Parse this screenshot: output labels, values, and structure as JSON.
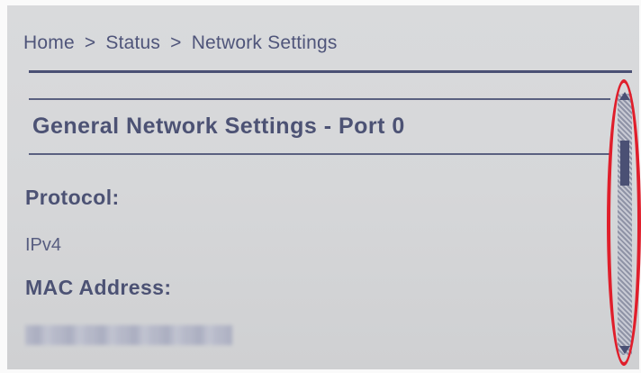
{
  "breadcrumb": {
    "items": [
      "Home",
      "Status",
      "Network Settings"
    ],
    "separator": ">"
  },
  "section": {
    "title": "General Network Settings - Port 0"
  },
  "fields": [
    {
      "label": "Protocol:",
      "value": "IPv4"
    },
    {
      "label": "MAC Address:",
      "value": ""
    }
  ],
  "scrollbar": {
    "up_icon": "triangle-up",
    "down_icon": "triangle-down",
    "position_fraction": 0.2
  },
  "annotation": {
    "color": "#e01e2b"
  }
}
